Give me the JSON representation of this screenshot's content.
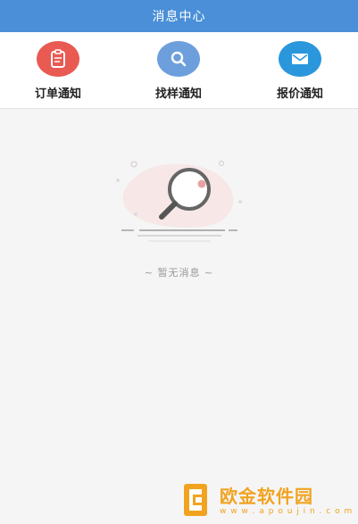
{
  "header": {
    "title": "消息中心",
    "color": "#4a8fd8"
  },
  "categories": [
    {
      "label": "订单通知",
      "icon": "clipboard-icon",
      "color": "#e85a52"
    },
    {
      "label": "找样通知",
      "icon": "search-icon",
      "color": "#6d9fdc"
    },
    {
      "label": "报价通知",
      "icon": "envelope-icon",
      "color": "#2a97dc"
    }
  ],
  "empty_state": {
    "message": "~ 暂无消息 ~",
    "icon": "magnifier-empty-icon"
  },
  "watermark": {
    "title": "欧金软件园",
    "url": "w w w . a p o u j i n . c o m",
    "color": "#f1a320"
  }
}
